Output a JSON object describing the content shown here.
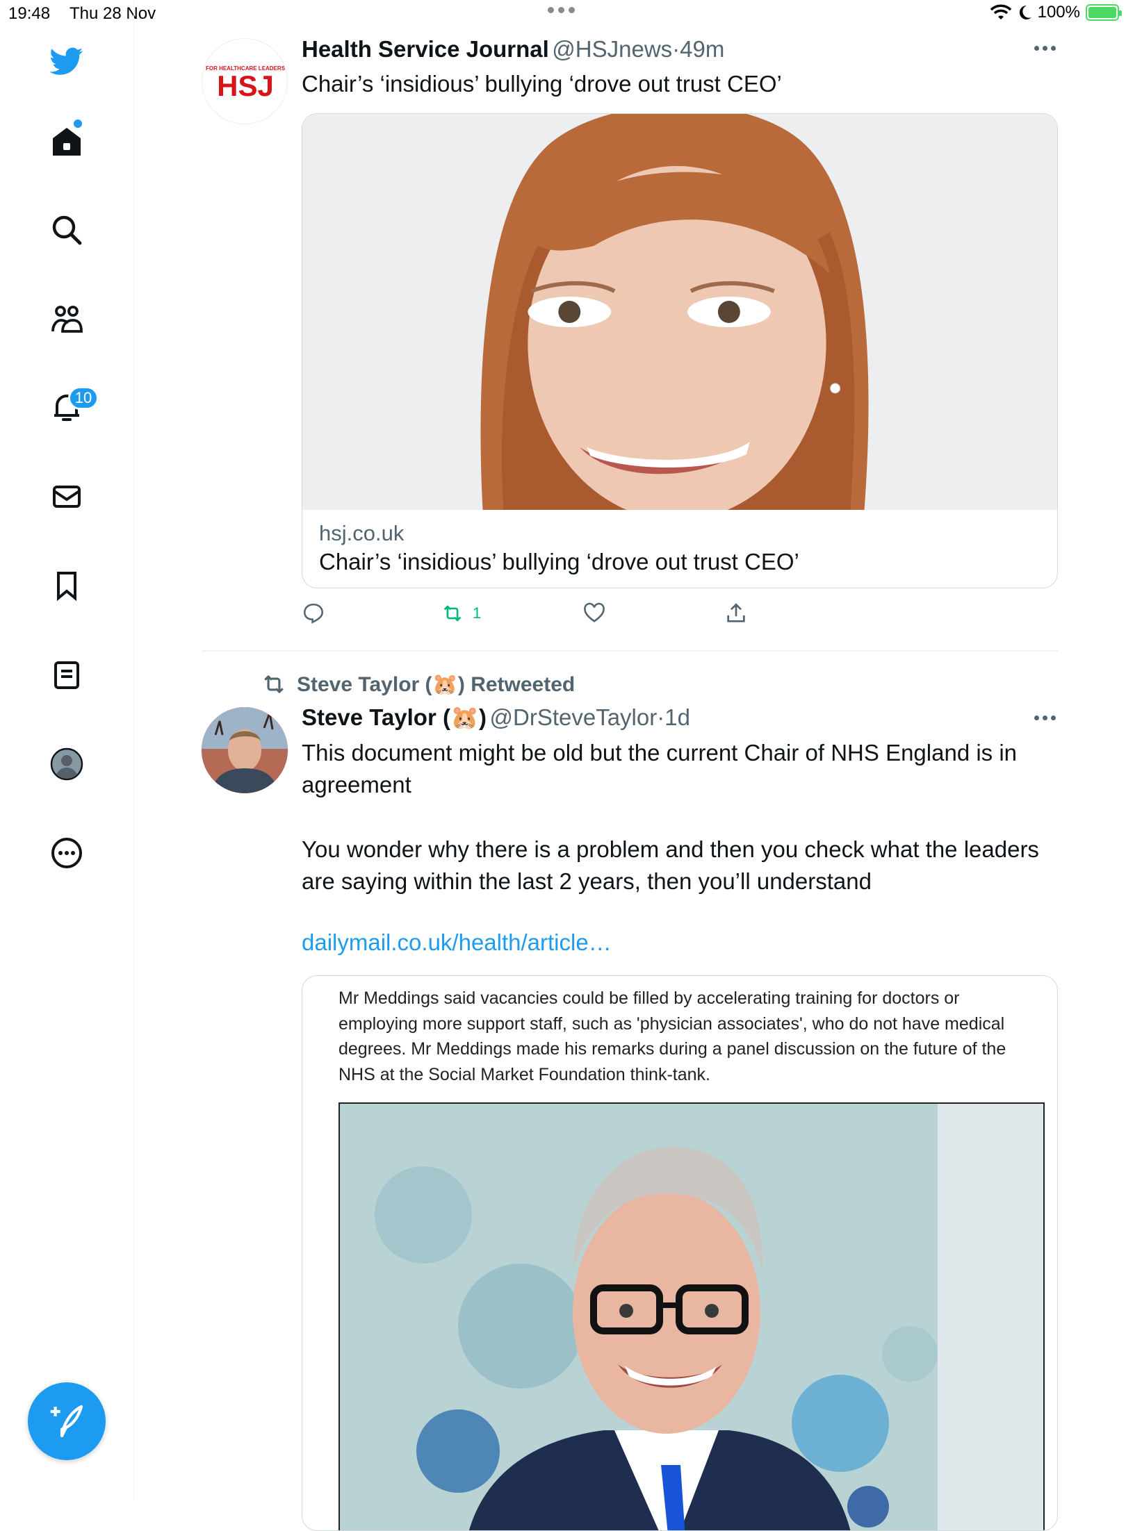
{
  "status_bar": {
    "time": "19:48",
    "date": "Thu 28 Nov",
    "battery": "100%"
  },
  "sidebar": {
    "items": [
      {
        "icon": "twitter-logo-icon"
      },
      {
        "icon": "home-icon"
      },
      {
        "icon": "search-icon"
      },
      {
        "icon": "communities-icon"
      },
      {
        "icon": "notifications-icon",
        "badge": "10"
      },
      {
        "icon": "messages-icon"
      },
      {
        "icon": "bookmarks-icon"
      },
      {
        "icon": "lists-icon"
      },
      {
        "icon": "profile-icon"
      },
      {
        "icon": "more-icon"
      }
    ],
    "compose_icon": "compose-icon"
  },
  "tweets": [
    {
      "author": "Health Service Journal",
      "handle": "@HSJnews",
      "time": "49m",
      "text": "Chair’s ‘insidious’ bullying ‘drove out trust CEO’",
      "avatar_text": "HSJ",
      "avatar_small": "FOR HEALTHCARE LEADERS",
      "card": {
        "domain": "hsj.co.uk",
        "title": "Chair’s ‘insidious’ bullying ‘drove out trust CEO’"
      },
      "retweet_count": "1"
    },
    {
      "retweeted_by": "Steve Taylor (🐹) Retweeted",
      "author": "Steve Taylor (🐹)",
      "handle": "@DrSteveTaylor",
      "time": "1d",
      "text_p1": "This document might be old but the current Chair of NHS England is in agreement",
      "text_p2": "You wonder why there is a problem and then you check what the leaders are saying within the last 2 years, then you’ll understand",
      "link": "dailymail.co.uk/health/article…",
      "doc_text": "Mr Meddings said vacancies could be filled by accelerating training for doctors or employing more support staff, such as 'physician associates', who do not have medical degrees. Mr Meddings made his remarks during a panel discussion on the future of the NHS at the Social Market Foundation think-tank."
    }
  ],
  "colors": {
    "accent": "#1d9bf0",
    "retweet_green": "#00ba7c",
    "hsj_red": "#d7141a",
    "text": "#0f1419",
    "muted": "#536471"
  }
}
